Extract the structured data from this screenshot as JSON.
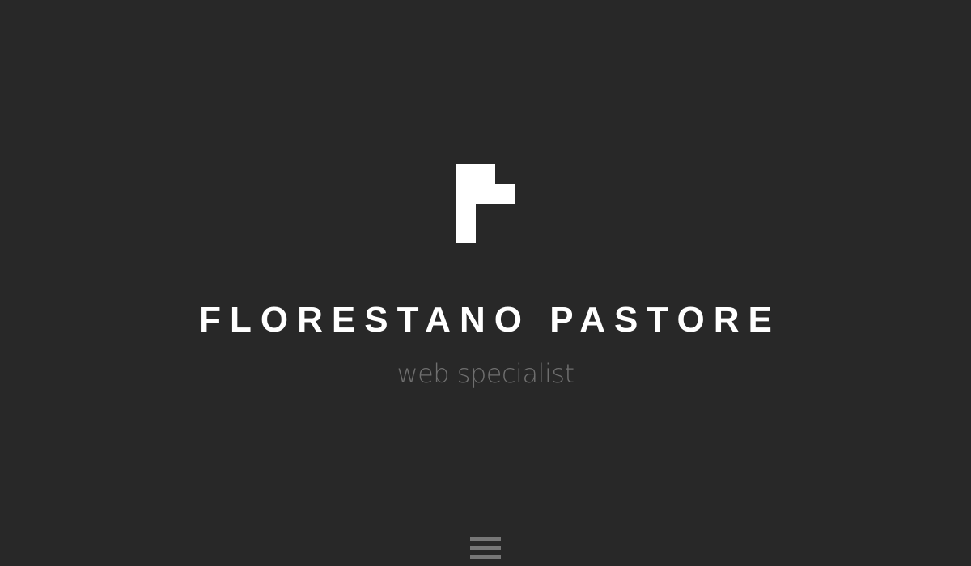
{
  "brand": {
    "name": "FLORESTANO PASTORE",
    "tagline": "web specialist",
    "logo_icon": "pixel-f-logo-icon"
  },
  "menu": {
    "icon": "hamburger-menu-icon"
  },
  "colors": {
    "background": "#282828",
    "name": "#ffffff",
    "tagline": "#6f6f6f",
    "menu_icon": "#777777"
  }
}
